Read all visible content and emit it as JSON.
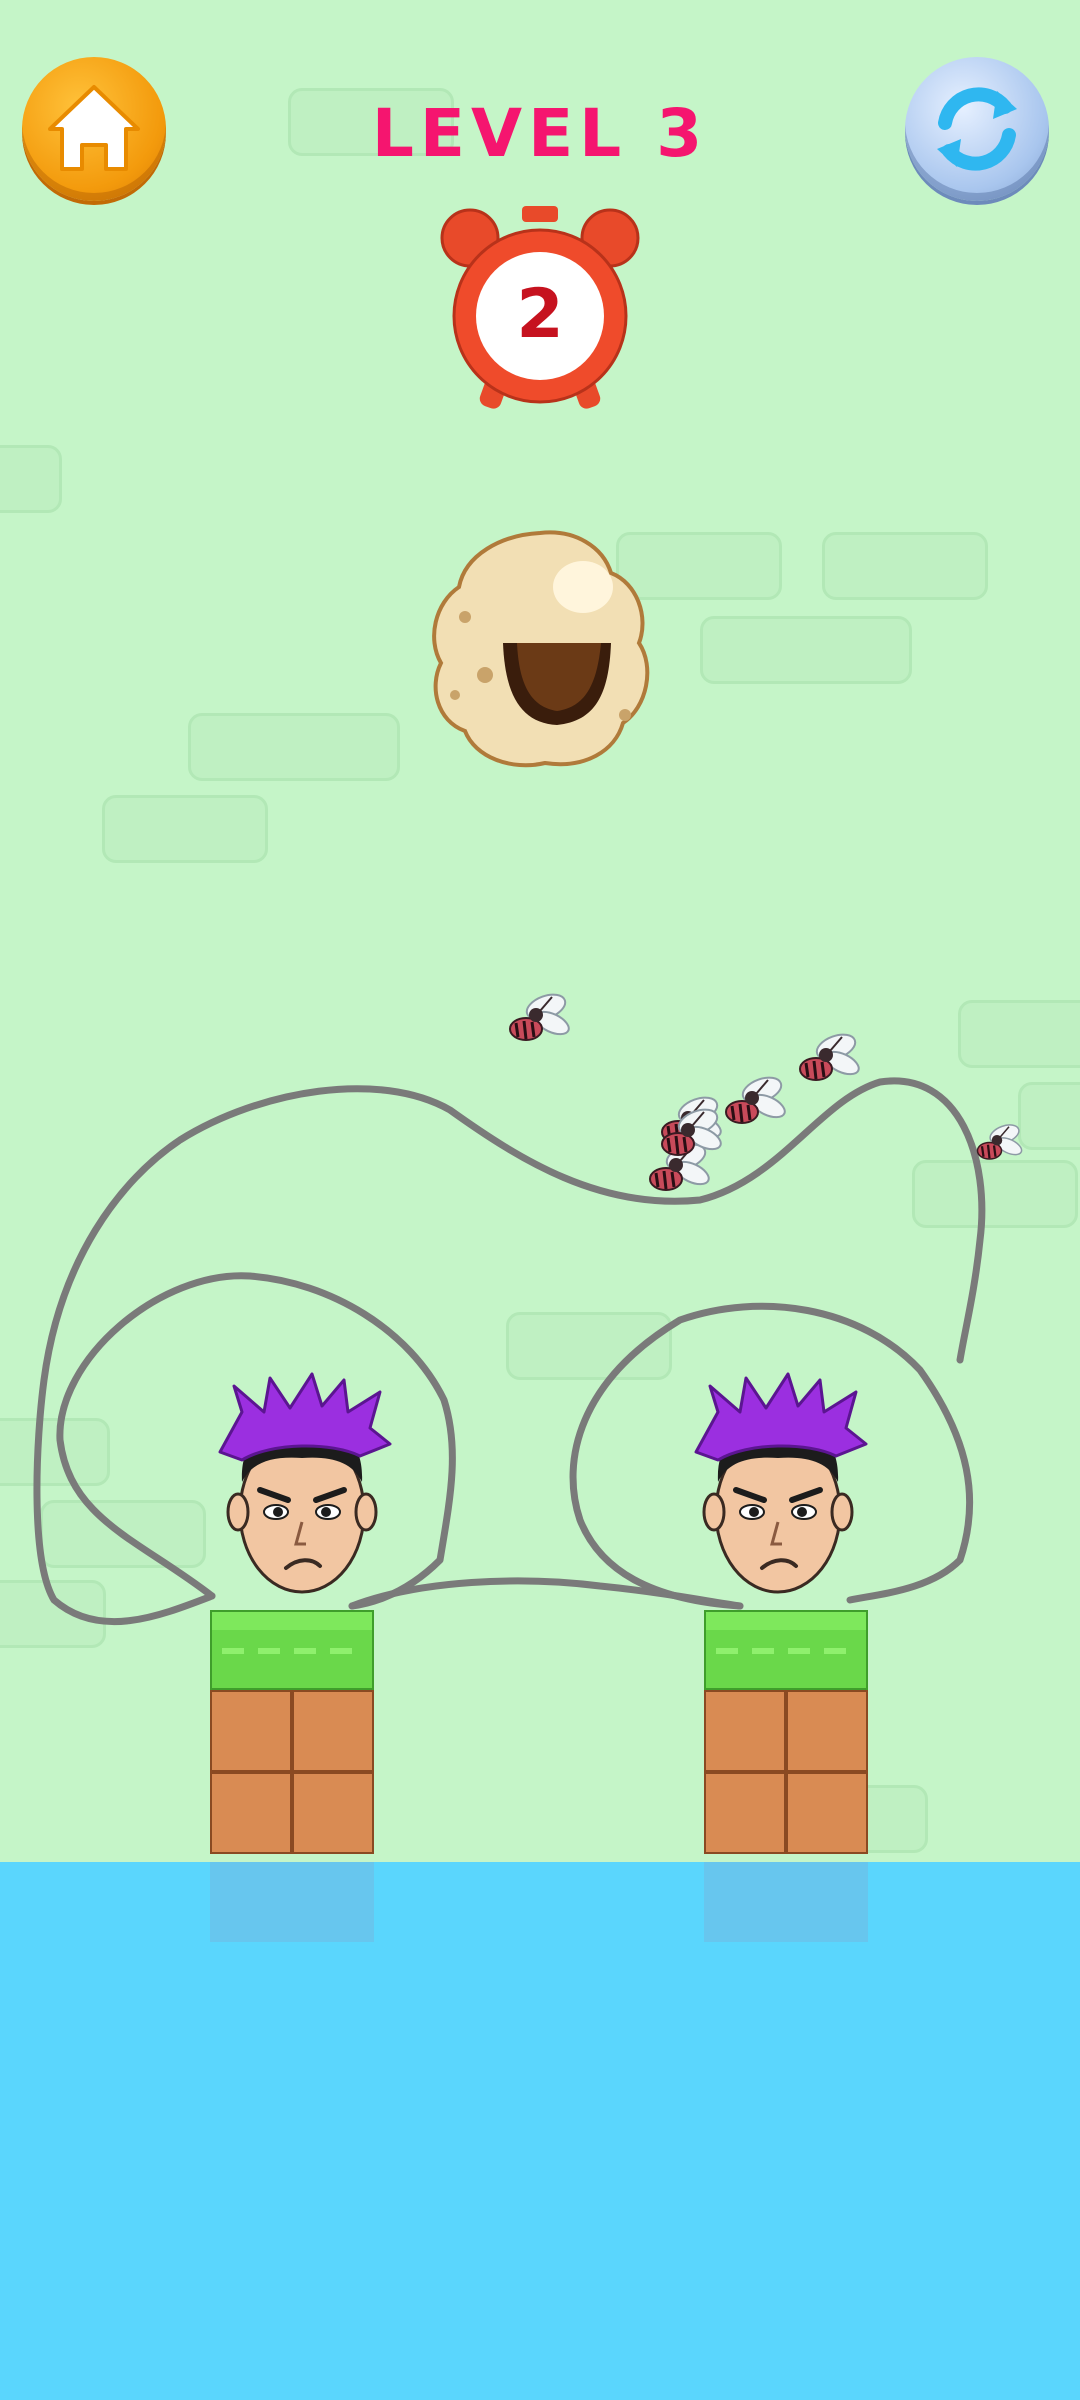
{
  "level": {
    "title": "LEVEL 3"
  },
  "timer": {
    "value": "2"
  },
  "buttons": {
    "home_icon": "home-icon",
    "restart_icon": "refresh-icon"
  },
  "colors": {
    "background": "#c5f5c8",
    "title": "#f5156f",
    "water": "#5ad6fd",
    "line": "#7a7a7a",
    "hair": "#9b2fe0"
  },
  "characters": [
    {
      "name": "left-player-head",
      "hair": "purple-spiky"
    },
    {
      "name": "right-player-head",
      "hair": "purple-spiky"
    }
  ],
  "enemies": {
    "type": "mosquito",
    "count": 7
  },
  "hazards": [
    "beehive",
    "water"
  ]
}
